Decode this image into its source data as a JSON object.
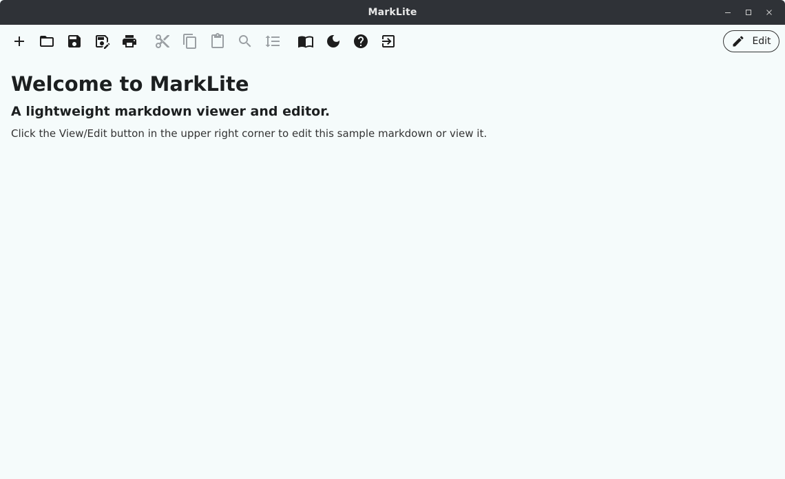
{
  "window": {
    "title": "MarkLite"
  },
  "toolbar": {
    "edit_label": "Edit",
    "buttons": [
      {
        "name": "new-file-button",
        "icon": "plus-icon",
        "enabled": true
      },
      {
        "name": "open-file-button",
        "icon": "folder-icon",
        "enabled": true
      },
      {
        "name": "save-button",
        "icon": "save-icon",
        "enabled": true
      },
      {
        "name": "save-as-button",
        "icon": "save-as-icon",
        "enabled": true
      },
      {
        "name": "print-button",
        "icon": "printer-icon",
        "enabled": true
      },
      {
        "name": "cut-button",
        "icon": "scissors-icon",
        "enabled": false
      },
      {
        "name": "copy-button",
        "icon": "copy-icon",
        "enabled": false
      },
      {
        "name": "paste-button",
        "icon": "clipboard-icon",
        "enabled": false
      },
      {
        "name": "find-button",
        "icon": "search-icon",
        "enabled": false
      },
      {
        "name": "line-spacing-button",
        "icon": "line-spacing-icon",
        "enabled": false
      },
      {
        "name": "reader-button",
        "icon": "open-book-icon",
        "enabled": true
      },
      {
        "name": "dark-mode-button",
        "icon": "moon-icon",
        "enabled": true
      },
      {
        "name": "help-button",
        "icon": "help-icon",
        "enabled": true
      },
      {
        "name": "exit-button",
        "icon": "exit-icon",
        "enabled": true
      }
    ]
  },
  "document": {
    "heading": "Welcome to MarkLite",
    "subheading": "A lightweight markdown viewer and editor.",
    "body": "Click the View/Edit button in the upper right corner to edit this sample markdown or view it."
  },
  "colors": {
    "titlebar": "#2f3237",
    "background": "#f5fbfb",
    "icon_enabled": "#1d1d1d",
    "icon_disabled": "#9a9fa3"
  }
}
